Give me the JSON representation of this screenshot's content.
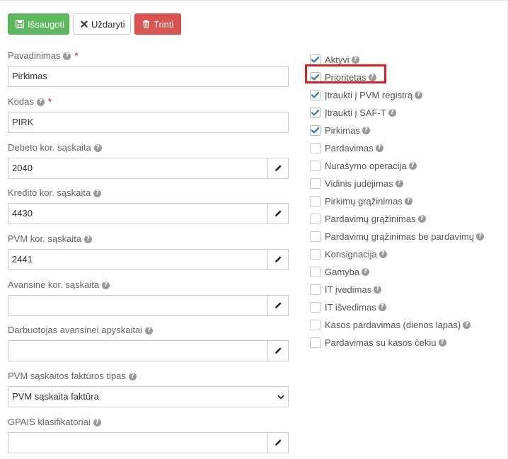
{
  "toolbar": {
    "save_label": "Išsaugoti",
    "close_label": "Uždaryti",
    "delete_label": "Trinti"
  },
  "form": {
    "name": {
      "label": "Pavadinimas",
      "value": "Pirkimas"
    },
    "code": {
      "label": "Kodas",
      "value": "PIRK"
    },
    "debit": {
      "label": "Debeto kor. sąskaita",
      "value": "2040"
    },
    "credit": {
      "label": "Kredito kor. sąskaita",
      "value": "4430"
    },
    "vat": {
      "label": "PVM kor. sąskaita",
      "value": "2441"
    },
    "advance": {
      "label": "Avansinė kor. sąskaita",
      "value": ""
    },
    "employee": {
      "label": "Darbuotojas avansinei apyskaitai",
      "value": ""
    },
    "invoice_type": {
      "label": "PVM sąskaitos faktūros tipas",
      "value": "PVM sąskaita faktūra"
    },
    "gpais": {
      "label": "GPAIS klasifikatoriai",
      "value": ""
    }
  },
  "checkboxes": [
    {
      "label": "Aktyvi",
      "checked": true
    },
    {
      "label": "Prioritetas",
      "checked": true
    },
    {
      "label": "Įtraukti į PVM registrą",
      "checked": true
    },
    {
      "label": "Įtraukti į SAF-T",
      "checked": true
    },
    {
      "label": "Pirkimas",
      "checked": true
    },
    {
      "label": "Pardavimas",
      "checked": false
    },
    {
      "label": "Nurašymo operacija",
      "checked": false
    },
    {
      "label": "Vidinis judėjimas",
      "checked": false
    },
    {
      "label": "Pirkimų grąžinimas",
      "checked": false
    },
    {
      "label": "Pardavimų grąžinimas",
      "checked": false
    },
    {
      "label": "Pardavimų grąžinimas be pardavimų",
      "checked": false
    },
    {
      "label": "Konsignacija",
      "checked": false
    },
    {
      "label": "Gamyba",
      "checked": false
    },
    {
      "label": "IT įvedimas",
      "checked": false
    },
    {
      "label": "IT išvedimas",
      "checked": false
    },
    {
      "label": "Kasos pardavimas (dienos lapas)",
      "checked": false
    },
    {
      "label": "Pardavimas su kasos čekiu",
      "checked": false
    }
  ],
  "help_glyph": "?",
  "colors": {
    "save": "#5cb85c",
    "delete": "#d9534f",
    "check": "#2a7ab8",
    "highlight": "#e02020"
  }
}
